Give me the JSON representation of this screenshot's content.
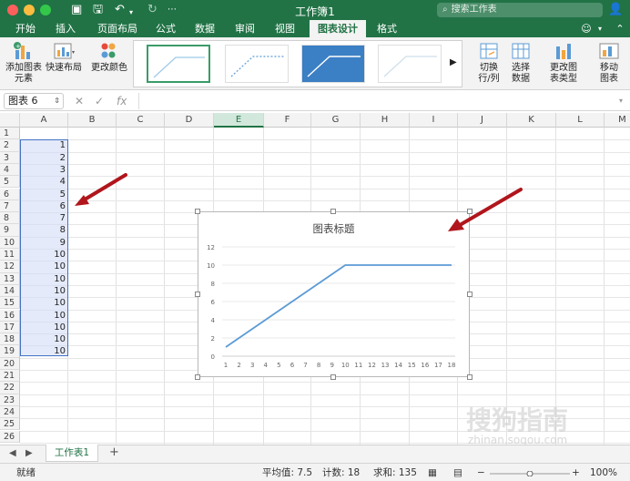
{
  "titlebar": {
    "title": "工作簿1",
    "search_placeholder": "搜索工作表"
  },
  "tabs": [
    {
      "label": "开始"
    },
    {
      "label": "插入"
    },
    {
      "label": "页面布局"
    },
    {
      "label": "公式"
    },
    {
      "label": "数据"
    },
    {
      "label": "审阅"
    },
    {
      "label": "视图"
    },
    {
      "label": "图表设计",
      "active": true
    },
    {
      "label": "格式"
    }
  ],
  "ribbon": {
    "add_element": "添加图表\n元素",
    "quick_layout": "快速布局",
    "change_colors": "更改颜色",
    "switch_row_col": "切换\n行/列",
    "select_data": "选择\n数据",
    "change_type": "更改图\n表类型",
    "move_chart": "移动\n图表"
  },
  "formula_bar": {
    "name_box": "图表 6",
    "fx": "fx",
    "value": ""
  },
  "grid": {
    "columns": [
      "A",
      "B",
      "C",
      "D",
      "E",
      "F",
      "G",
      "H",
      "I",
      "J",
      "K",
      "L",
      "M"
    ],
    "selected_column": "E",
    "rows": [
      "1",
      "2",
      "3",
      "4",
      "5",
      "6",
      "7",
      "8",
      "9",
      "10",
      "11",
      "12",
      "13",
      "14",
      "15",
      "16",
      "17",
      "18",
      "19",
      "20",
      "21",
      "22",
      "23",
      "24",
      "25",
      "26"
    ],
    "column_a_values": [
      "",
      "1",
      "2",
      "3",
      "4",
      "5",
      "6",
      "7",
      "8",
      "9",
      "10",
      "10",
      "10",
      "10",
      "10",
      "10",
      "10",
      "10",
      "10"
    ]
  },
  "chart_data": {
    "type": "line",
    "title": "图表标题",
    "x": [
      1,
      2,
      3,
      4,
      5,
      6,
      7,
      8,
      9,
      10,
      11,
      12,
      13,
      14,
      15,
      16,
      17,
      18
    ],
    "series": [
      {
        "values": [
          1,
          2,
          3,
          4,
          5,
          6,
          7,
          8,
          9,
          10,
          10,
          10,
          10,
          10,
          10,
          10,
          10,
          10
        ],
        "color": "#5b9bd5"
      }
    ],
    "ylim": [
      0,
      12
    ],
    "yticks": [
      0,
      2,
      4,
      6,
      8,
      10,
      12
    ],
    "grid": true,
    "xlabel": "",
    "ylabel": ""
  },
  "sheet_tabs": {
    "active": "工作表1",
    "add_label": "+"
  },
  "status_bar": {
    "mode": "就绪",
    "average": "平均值: 7.5",
    "count": "计数: 18",
    "sum": "求和: 135",
    "zoom": "100%"
  },
  "watermark": {
    "text": "搜狗指南",
    "url": "zhinan.sogou.com"
  },
  "colors": {
    "accent": "#217346",
    "line": "#5b9bd5",
    "arrow": "#b0161c"
  }
}
